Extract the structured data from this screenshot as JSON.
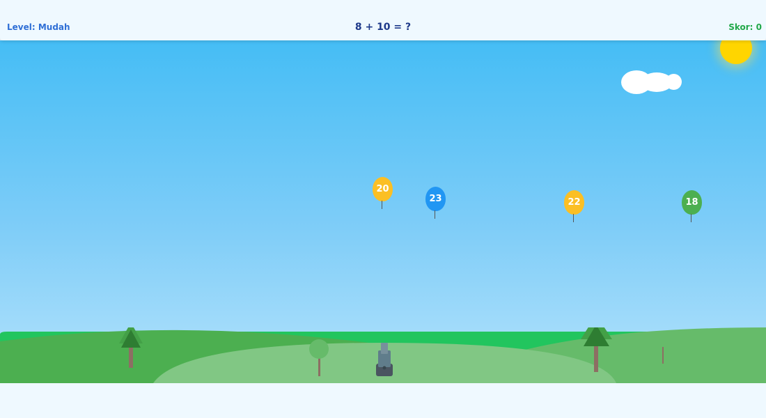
{
  "header": {
    "level_text": "Level: Mudah",
    "question_text": "8 + 10 = ?",
    "score_text": "Skor: 0"
  },
  "colors": {
    "level": "#2f6fd6",
    "question": "#1e3a8a",
    "score": "#22a84a",
    "sky_top": "#45bdf5",
    "sky_bottom": "#b4e3fb",
    "sun": "#ffd500"
  },
  "balloons": [
    {
      "value": "20",
      "color": "#fbbf24"
    },
    {
      "value": "23",
      "color": "#2196f3"
    },
    {
      "value": "22",
      "color": "#fbbf24"
    },
    {
      "value": "18",
      "color": "#4caf50"
    }
  ],
  "scenery": {
    "sun_icon": "sun-icon",
    "cloud_icon": "cloud-icon",
    "cannon_icon": "cannon-icon"
  }
}
